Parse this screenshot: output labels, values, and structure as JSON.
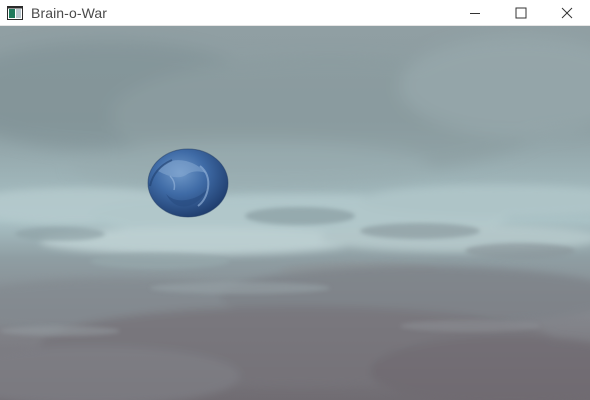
{
  "window": {
    "title": "Brain-o-War",
    "icon": "app-window-icon",
    "controls": [
      {
        "name": "minimize-icon"
      },
      {
        "name": "maximize-icon"
      },
      {
        "name": "close-icon"
      }
    ]
  },
  "game": {
    "scene": "cloudy-sky",
    "object": "blue-brain-sphere",
    "colors": {
      "sky": "#8aa1a5",
      "haze": "#a9c0c3",
      "ground": "#77767b",
      "orb": "#3b6aa6"
    }
  }
}
